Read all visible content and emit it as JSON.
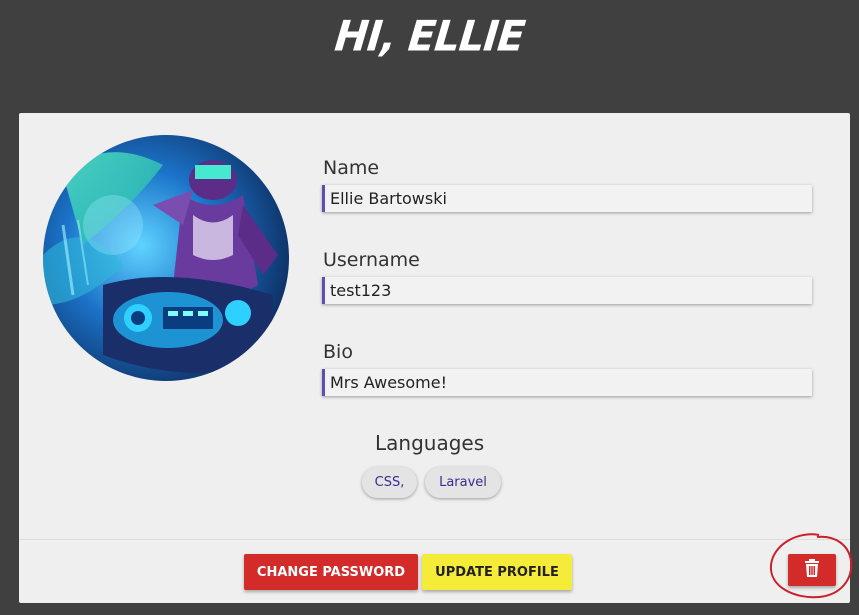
{
  "header": {
    "greeting": "HI, ELLIE"
  },
  "profile": {
    "name_label": "Name",
    "name_value": "Ellie Bartowski",
    "username_label": "Username",
    "username_value": "test123",
    "bio_label": "Bio",
    "bio_value": "Mrs Awesome!"
  },
  "languages": {
    "title": "Languages",
    "items": [
      "CSS,",
      "Laravel"
    ]
  },
  "actions": {
    "change_password": "CHANGE PASSWORD",
    "update_profile": "UPDATE PROFILE",
    "delete_icon": "trash-icon"
  },
  "colors": {
    "accent_input_border": "#5e4db2",
    "danger": "#d32a2a",
    "warning": "#f5ec3a",
    "annotation": "#cc1f2a"
  }
}
